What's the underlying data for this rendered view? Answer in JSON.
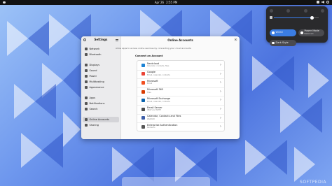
{
  "topbar": {
    "date": "Apr 26",
    "time": "2:55 PM"
  },
  "quick_settings": {
    "volume_level": 0.72,
    "buttons": [
      {
        "label": "Wired",
        "sub": "",
        "active": true
      },
      {
        "label": "Power Mode",
        "sub": "Balanced",
        "active": false
      },
      {
        "label": "Dark Style",
        "sub": "",
        "active": false
      }
    ]
  },
  "settings": {
    "sidebar_title": "Settings",
    "sidebar_items": [
      {
        "label": "Network",
        "icon": "network-icon"
      },
      {
        "label": "Bluetooth",
        "icon": "bluetooth-icon"
      },
      {
        "label": "Displays",
        "icon": "display-icon"
      },
      {
        "label": "Sound",
        "icon": "sound-icon"
      },
      {
        "label": "Power",
        "icon": "power-icon"
      },
      {
        "label": "Multitasking",
        "icon": "multitasking-icon"
      },
      {
        "label": "Appearance",
        "icon": "appearance-icon"
      },
      {
        "label": "Apps",
        "icon": "apps-icon"
      },
      {
        "label": "Notifications",
        "icon": "bell-icon"
      },
      {
        "label": "Search",
        "icon": "search-icon"
      },
      {
        "label": "Online Accounts",
        "icon": "accounts-icon",
        "active": true
      },
      {
        "label": "Sharing",
        "icon": "share-icon"
      }
    ],
    "page_title": "Online Accounts",
    "intro": "Allow apps to access online services by connecting your cloud accounts",
    "section_title": "Connect an Account",
    "providers": [
      {
        "name": "Nextcloud",
        "sub": "Calendar, contacts, files",
        "color": "#1a82d4"
      },
      {
        "name": "Google",
        "sub": "Email, calendar, contacts",
        "color": "#ea4335"
      },
      {
        "name": "Microsoft",
        "sub": "Email",
        "color": "#f25022"
      },
      {
        "name": "Microsoft 365",
        "sub": "Files",
        "color": "#d83b01"
      },
      {
        "name": "Microsoft Exchange",
        "sub": "Email, calendar, contacts",
        "color": "#0a64ad"
      },
      {
        "name": "Email Server",
        "sub": "IMAP and SMTP",
        "color": "#4b4b4b"
      },
      {
        "name": "Calendar, Contacts and Files",
        "sub": "WebDAV",
        "color": "#3d5ea8"
      },
      {
        "name": "Enterprise Authentication",
        "sub": "Kerberos",
        "color": "#555555"
      }
    ]
  },
  "watermark": "SOFTPEDIA"
}
